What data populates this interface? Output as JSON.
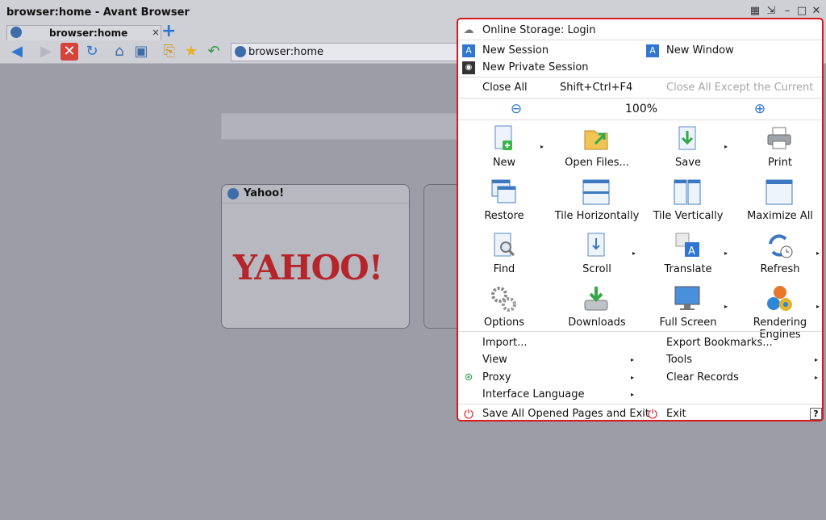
{
  "window": {
    "title": "browser:home - Avant Browser",
    "tab_title": "browser:home",
    "tab_close": "×",
    "new_tab": "+",
    "address": "browser:home"
  },
  "thumbnail": {
    "title": "Yahoo!",
    "logo_text": "YAHOO!"
  },
  "menu": {
    "online_storage": "Online Storage: Login",
    "new_session": "New Session",
    "new_window": "New Window",
    "new_private_session": "New Private Session",
    "close_all": "Close All",
    "close_all_shortcut": "Shift+Ctrl+F4",
    "close_all_except": "Close All Except the Current",
    "zoom": "100%",
    "grid": [
      {
        "label": "New"
      },
      {
        "label": "Open Files..."
      },
      {
        "label": "Save"
      },
      {
        "label": "Print"
      },
      {
        "label": "Restore"
      },
      {
        "label": "Tile Horizontally"
      },
      {
        "label": "Tile Vertically"
      },
      {
        "label": "Maximize All"
      },
      {
        "label": "Find"
      },
      {
        "label": "Scroll"
      },
      {
        "label": "Translate"
      },
      {
        "label": "Refresh"
      },
      {
        "label": "Options"
      },
      {
        "label": "Downloads"
      },
      {
        "label": "Full Screen"
      },
      {
        "label": "Rendering Engines"
      }
    ],
    "import": "Import...",
    "export_bookmarks": "Export Bookmarks...",
    "view": "View",
    "tools": "Tools",
    "proxy": "Proxy",
    "clear_records": "Clear Records",
    "interface_language": "Interface Language",
    "save_all_exit": "Save All Opened Pages and Exit",
    "exit": "Exit",
    "help": "?"
  },
  "colors": {
    "accent_border": "#d71920",
    "toolbar_blue": "#2f76d2"
  }
}
